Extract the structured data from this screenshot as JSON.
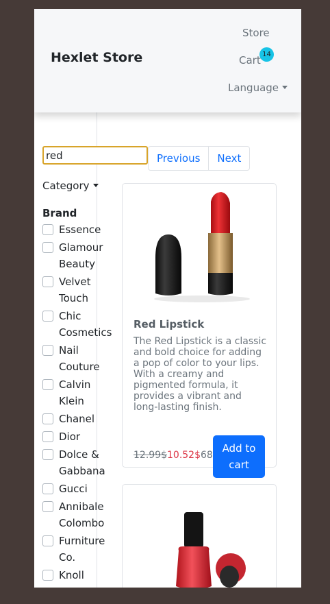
{
  "navbar": {
    "brand": "Hexlet Store",
    "store_label": "Store",
    "cart_label": "Cart",
    "cart_count": "14",
    "language_label": "Language"
  },
  "search": {
    "value": "red"
  },
  "pagination": {
    "previous": "Previous",
    "next": "Next"
  },
  "filters": {
    "category_label": "Category",
    "brand_heading": "Brand",
    "brands": [
      "Essence",
      "Glamour Beauty",
      "Velvet Touch",
      "Chic Cosmetics",
      "Nail Couture",
      "Calvin Klein",
      "Chanel",
      "Dior",
      "Dolce & Gabbana",
      "Gucci",
      "Annibale Colombo",
      "Furniture Co.",
      "Knoll"
    ]
  },
  "products": [
    {
      "title": "Red Lipstick",
      "description": "The Red Lipstick is a classic and bold choice for adding a pop of color to your lips. With a creamy and pigmented formula, it provides a vibrant and long-lasting finish.",
      "old_price": "12.99$",
      "new_price": "10.52$",
      "stock": "68",
      "add_label": "Add to cart",
      "image_icon": "lipstick-image"
    },
    {
      "image_icon": "nail-polish-image"
    }
  ],
  "colors": {
    "accent": "#0d6efd",
    "badge": "#17c3e6",
    "sale_price": "#dc3545",
    "search_focus": "#d8a42a",
    "backdrop": "#463a37"
  }
}
